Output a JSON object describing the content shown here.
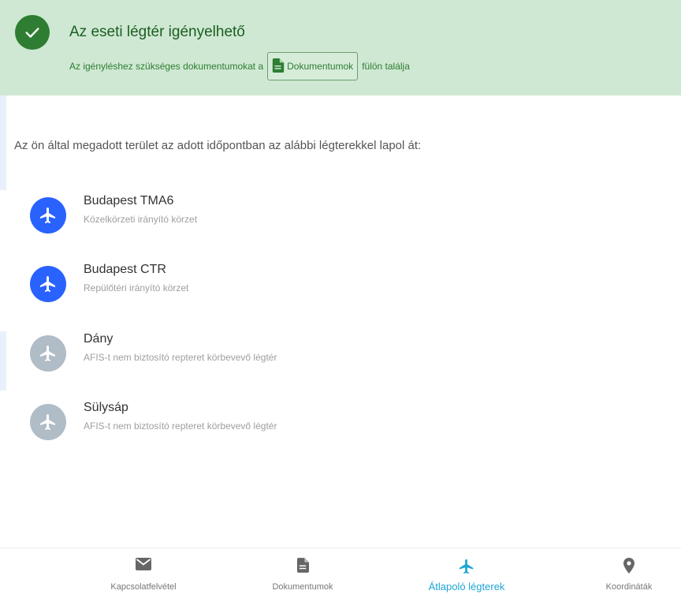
{
  "banner": {
    "title": "Az eseti légtér igényelhető",
    "subtitle_before": "Az igényléshez szükséges dokumentumokat a",
    "chip_label": "Dokumentumok",
    "subtitle_after": "fülön találja",
    "color": "#2e7d32",
    "background": "#cfe8d3"
  },
  "intro": "Az ön által megadott terület az adott időpontban az alábbi légterekkel lapol át:",
  "airspaces": [
    {
      "name": "Budapest TMA6",
      "description": "Közelkörzeti irányító körzet",
      "icon": "airplane-icon",
      "status": "active",
      "color": "#2962ff"
    },
    {
      "name": "Budapest CTR",
      "description": "Repülőtéri irányító körzet",
      "icon": "airplane-icon",
      "status": "active",
      "color": "#2962ff"
    },
    {
      "name": "Dány",
      "description": "AFIS-t nem biztosító repteret körbevevő légtér",
      "icon": "airplane-icon",
      "status": "inactive",
      "color": "#b0bcc6"
    },
    {
      "name": "Sülysáp",
      "description": "AFIS-t nem biztosító repteret körbevevő légtér",
      "icon": "airplane-icon",
      "status": "inactive",
      "color": "#b0bcc6"
    }
  ],
  "bottom_nav": [
    {
      "label": "Kapcsolatfelvétel",
      "icon": "mail-icon",
      "active": false
    },
    {
      "label": "Dokumentumok",
      "icon": "document-icon",
      "active": false
    },
    {
      "label": "Átlapoló légterek",
      "icon": "airplane-icon",
      "active": true
    },
    {
      "label": "Koordináták",
      "icon": "location-pin-icon",
      "active": false
    }
  ],
  "accent_color": "#1ea5d6"
}
